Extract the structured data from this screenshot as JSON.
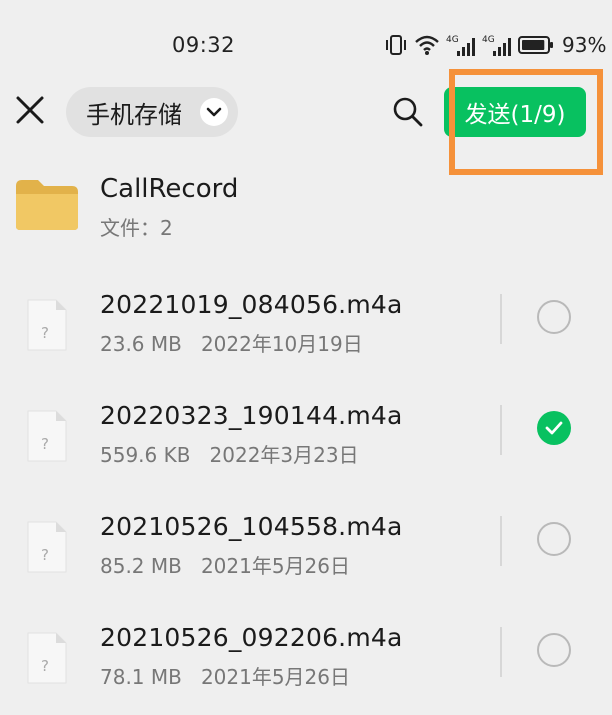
{
  "status_bar": {
    "time": "09:32",
    "signal1_label": "4G",
    "signal2_label": "4G",
    "battery_percent": "93%",
    "battery_level": 0.93
  },
  "top_bar": {
    "storage_label": "手机存储",
    "send_label": "发送(1/9)",
    "accent_color": "#08c160",
    "highlight_color": "#f5913a"
  },
  "folder": {
    "name": "CallRecord",
    "meta": "文件：2"
  },
  "files": [
    {
      "name": "20221019_084056.m4a",
      "size": "23.6 MB",
      "date": "2022年10月19日",
      "meta": "23.6 MB   2022年10月19日",
      "selected": false
    },
    {
      "name": "20220323_190144.m4a",
      "size": "559.6 KB",
      "date": "2022年3月23日",
      "meta": "559.6 KB   2022年3月23日",
      "selected": true
    },
    {
      "name": "20210526_104558.m4a",
      "size": "85.2 MB",
      "date": "2021年5月26日",
      "meta": "85.2 MB   2021年5月26日",
      "selected": false
    },
    {
      "name": "20210526_092206.m4a",
      "size": "78.1 MB",
      "date": "2021年5月26日",
      "meta": "78.1 MB   2021年5月26日",
      "selected": false
    }
  ],
  "icons": {
    "close": "close-icon",
    "chevron": "chevron-down-icon",
    "search": "search-icon",
    "folder": "folder-icon",
    "file": "unknown-file-icon",
    "check": "check-icon"
  }
}
